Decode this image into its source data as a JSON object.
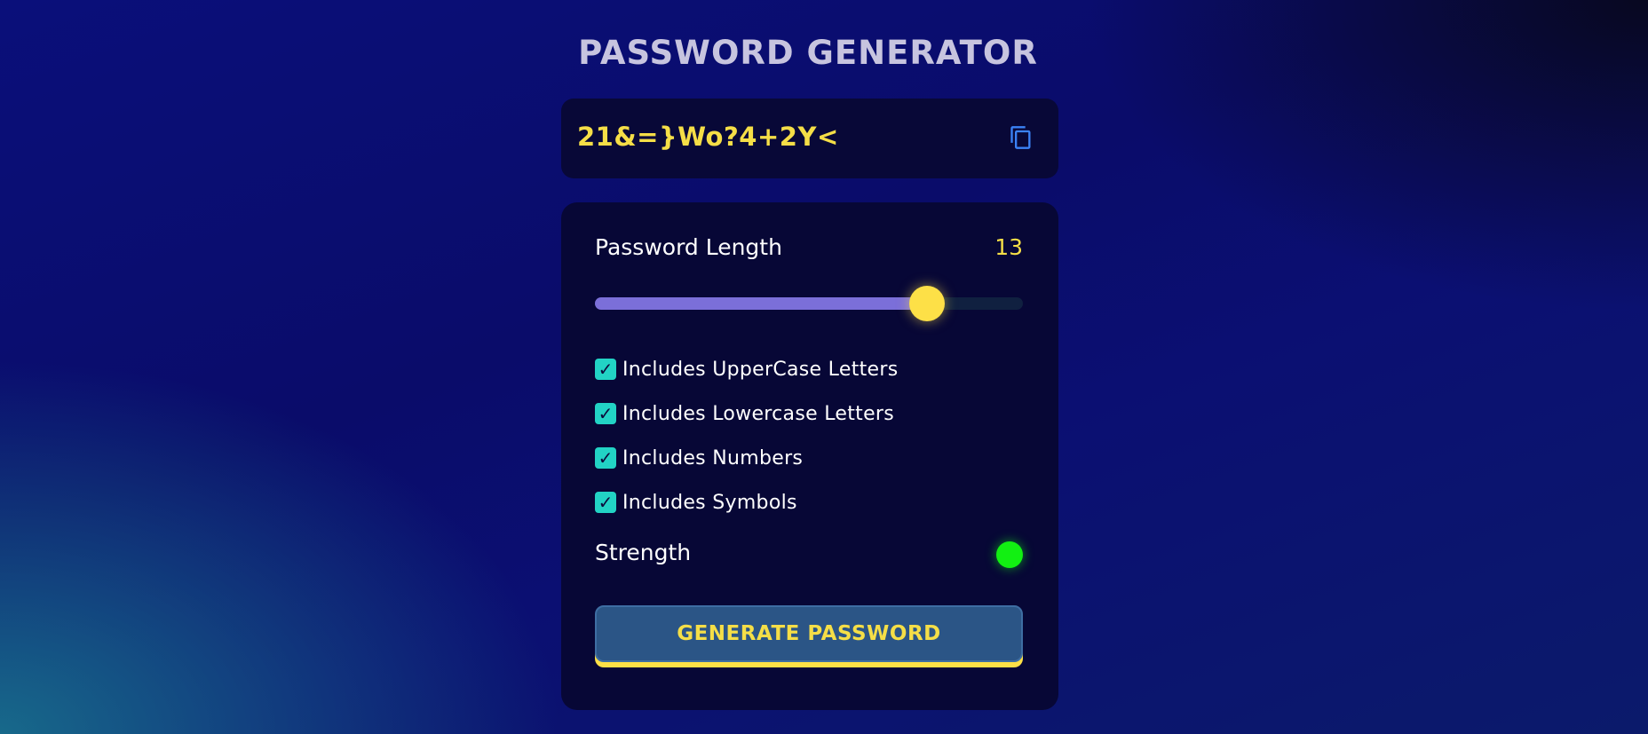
{
  "app": {
    "title": "PASSWORD GENERATOR"
  },
  "display": {
    "password": "21&=}Wo?4+2Y<",
    "copy_icon": "copy-icon"
  },
  "length": {
    "label": "Password Length",
    "value": "13",
    "slider_fraction": 0.775
  },
  "options": [
    {
      "label": "Includes UpperCase Letters",
      "checked": true
    },
    {
      "label": "Includes Lowercase Letters",
      "checked": true
    },
    {
      "label": "Includes Numbers",
      "checked": true
    },
    {
      "label": "Includes Symbols",
      "checked": true
    }
  ],
  "strength": {
    "label": "Strength",
    "indicator_color": "#12f012"
  },
  "actions": {
    "generate_label": "GENERATE PASSWORD"
  },
  "colors": {
    "accent_yellow": "#fde047",
    "checkbox_teal": "#22d3c5",
    "slider_fill": "#7b6fd9",
    "button_blue": "#2b5586",
    "copy_icon_blue": "#3b82f6"
  }
}
